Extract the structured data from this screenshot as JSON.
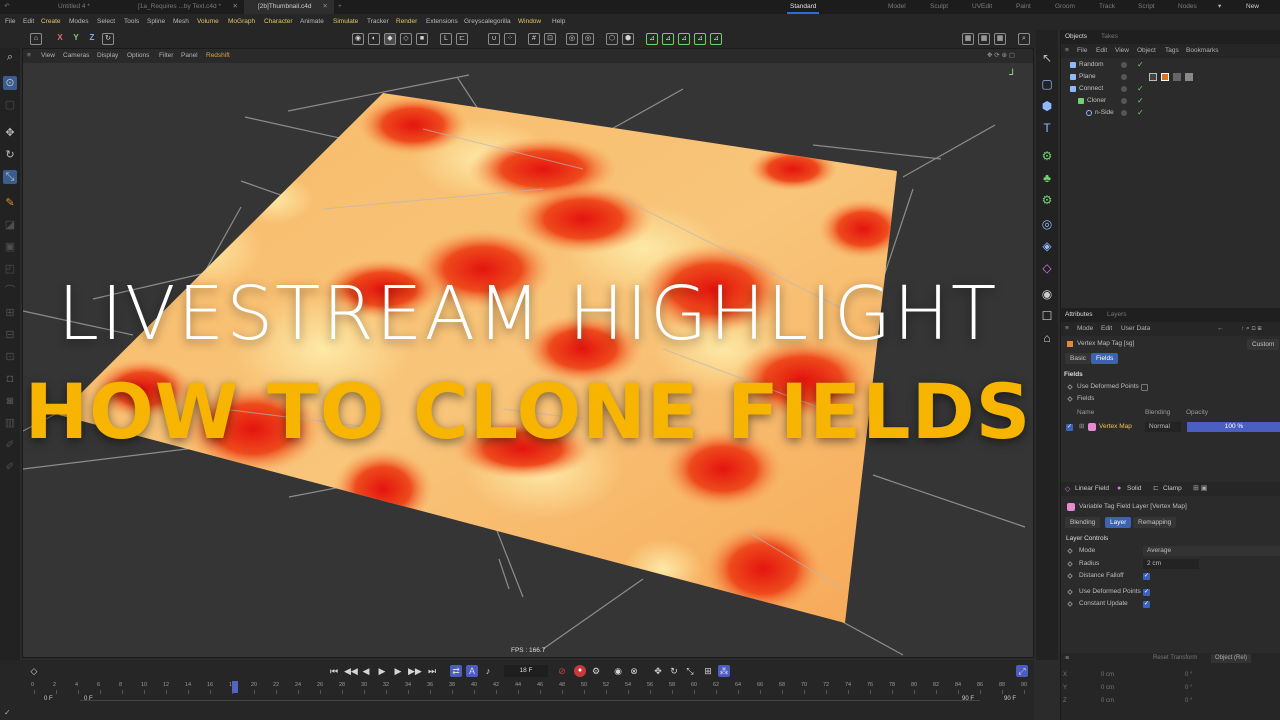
{
  "tabs": [
    {
      "label": "Untitled 4 *"
    },
    {
      "label": "[1a_Requires ...by Text.c4d *"
    },
    {
      "label": "[2b]Thumbnail.c4d"
    }
  ],
  "layouts": [
    "Standard",
    "Model",
    "Sculpt",
    "UVEdit",
    "Paint",
    "Groom",
    "Track",
    "Script",
    "Nodes"
  ],
  "layout_new": "New Layout",
  "menu": [
    "File",
    "Edit",
    "Create",
    "Modes",
    "Select",
    "Tools",
    "Spline",
    "Mesh",
    "Volume",
    "MoGraph",
    "Character",
    "Animate",
    "Simulate",
    "Tracker",
    "Render",
    "Extensions",
    "Greyscalegorilla",
    "Window",
    "Help"
  ],
  "axis": {
    "x": "X",
    "y": "Y",
    "z": "Z"
  },
  "viewport_menu": [
    "View",
    "Cameras",
    "Display",
    "Options",
    "Filter",
    "Panel",
    "Redshift"
  ],
  "overlay": {
    "title_line1": "LIVESTREAM HIGHLIGHT",
    "title_line2": "HOW TO CLONE FIELDS"
  },
  "fps": "FPS : 166.7",
  "object_panel": {
    "tabs": [
      "Objects",
      "Takes"
    ],
    "menu": [
      "File",
      "Edit",
      "View",
      "Object",
      "Tags",
      "Bookmarks"
    ],
    "objects": [
      {
        "name": "Random",
        "color": "#8fb8ff"
      },
      {
        "name": "Plane",
        "color": "#8fb8ff"
      },
      {
        "name": "Connect",
        "color": "#8fb8ff"
      },
      {
        "name": "Cloner",
        "color": "#8fb8ff"
      },
      {
        "name": "n-Side",
        "color": "#8fb8ff"
      }
    ]
  },
  "attributes": {
    "tabs": [
      "Attributes",
      "Layers"
    ],
    "menu": [
      "Mode",
      "Edit",
      "User Data"
    ],
    "tag_title": "Vertex Map Tag [sg]",
    "custom": "Custom",
    "sub_tabs": [
      "Basic",
      "Fields"
    ],
    "section_fields": "Fields",
    "use_deformed_points": "Use Deformed Points",
    "fields_label": "Fields",
    "columns": {
      "name": "Name",
      "blending": "Blending",
      "opacity": "Opacity"
    },
    "layer_row": {
      "name": "Vertex Map",
      "blending": "Normal",
      "opacity": "100 %",
      "opacity_value": 1.0
    },
    "field_tools": [
      "Linear Field",
      "Solid",
      "Clamp"
    ],
    "layer_title": "Variable Tag Field Layer [Vertex Map]",
    "layer_tabs": [
      "Blending",
      "Layer",
      "Remapping"
    ],
    "layer_controls": "Layer Controls",
    "mode_label": "Mode",
    "mode_value": "Average",
    "radius_label": "Radius",
    "radius_value": "2 cm",
    "distance_falloff": "Distance Falloff",
    "use_deformed": "Use Deformed Points",
    "constant_update": "Constant Update"
  },
  "coords": {
    "reset": "Reset Transform",
    "mode": "Object (Rel)",
    "rows": [
      {
        "axis": "X",
        "pos": "0 cm",
        "rot": "0 °"
      },
      {
        "axis": "Y",
        "pos": "0 cm",
        "rot": "0 °"
      },
      {
        "axis": "Z",
        "pos": "0 cm",
        "rot": "0 °"
      }
    ]
  },
  "timeline": {
    "current_frame": "18 F",
    "ruler": [
      "0",
      "2",
      "4",
      "6",
      "8",
      "10",
      "12",
      "14",
      "16",
      "18",
      "20",
      "22",
      "24",
      "26",
      "28",
      "30",
      "32",
      "34",
      "36",
      "38",
      "40",
      "42",
      "44",
      "46",
      "48",
      "50",
      "52",
      "54",
      "56",
      "58",
      "60",
      "62",
      "64",
      "66",
      "68",
      "70",
      "72",
      "74",
      "76",
      "78",
      "80",
      "82",
      "84",
      "86",
      "88",
      "90"
    ],
    "start": "0 F",
    "start2": "0 F",
    "end": "90 F",
    "end2": "90 F"
  },
  "colors": {
    "accent": "#2d6cdf",
    "title_yellow": "#f7b400",
    "plane_red": "#e01e12",
    "plane_yellow": "#fbe08e"
  }
}
